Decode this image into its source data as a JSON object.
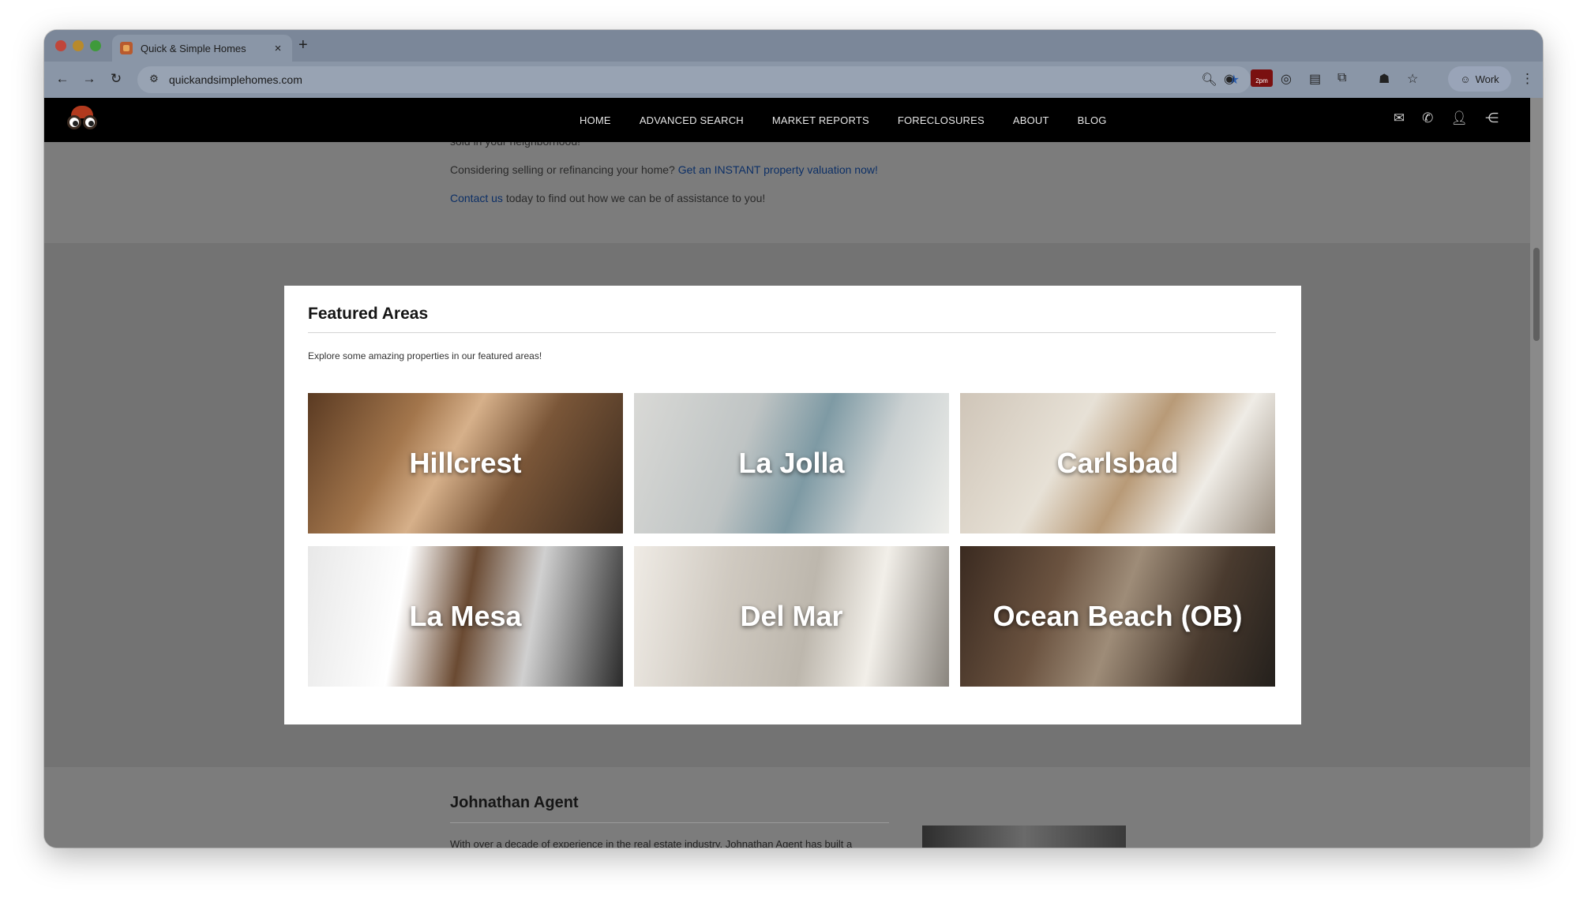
{
  "browser": {
    "tab_title": "Quick & Simple Homes",
    "tab_close": "×",
    "new_tab": "+",
    "url": "quickandsimplehomes.com",
    "profile_label": "Work",
    "ext_badge": "2pm"
  },
  "site": {
    "nav": [
      "HOME",
      "ADVANCED SEARCH",
      "MARKET REPORTS",
      "FORECLOSURES",
      "ABOUT",
      "BLOG"
    ],
    "intro_partial": "sold in your neighborhood!",
    "intro_line2_text": "Considering selling or refinancing your home?",
    "intro_line2_link": "Get an INSTANT property valuation now!",
    "intro_line3_link": "Contact us",
    "intro_line3_text": "today to find out how we can be of assistance to you!"
  },
  "modal": {
    "title": "Featured Areas",
    "subtitle": "Explore some amazing properties in our featured areas!",
    "areas": [
      "Hillcrest",
      "La Jolla",
      "Carlsbad",
      "La Mesa",
      "Del Mar",
      "Ocean Beach (OB)"
    ]
  },
  "agent": {
    "name": "Johnathan Agent",
    "bio": "With over a decade of experience in the real estate industry, Johnathan Agent has built a"
  },
  "colors": {
    "site_nav_bg": "#000000",
    "link": "#0c2f66",
    "modal_bg": "#ffffff"
  }
}
